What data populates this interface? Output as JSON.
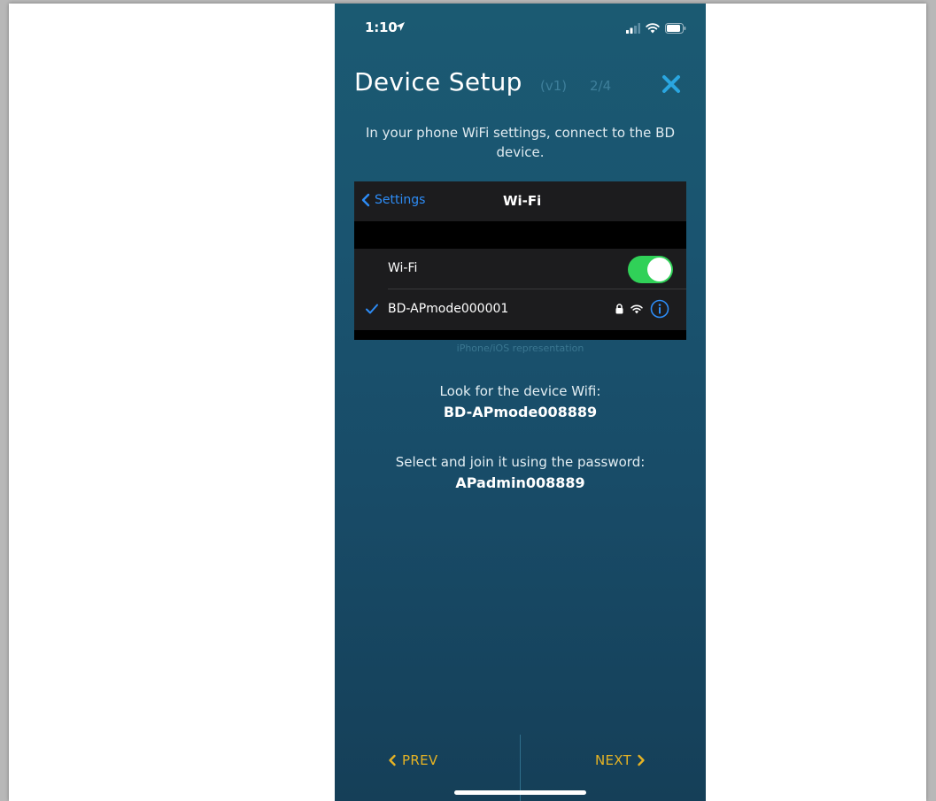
{
  "status_bar": {
    "time": "1:10",
    "icons": [
      "location-arrow-icon",
      "signal-icon",
      "wifi-icon",
      "battery-icon"
    ]
  },
  "header": {
    "title": "Device Setup",
    "version": "(v1)",
    "step": "2/4",
    "close_icon": "close-icon"
  },
  "intro_text": "In your phone WiFi settings, connect to the BD device.",
  "wifi_screenshot": {
    "back_label": "Settings",
    "title": "Wi-Fi",
    "toggle_label": "Wi-Fi",
    "toggle_on": true,
    "network_name": "BD-APmode000001",
    "network_icons": [
      "lock-icon",
      "wifi-icon",
      "info-icon"
    ],
    "caption": "iPhone/iOS representation"
  },
  "device_wifi": {
    "label": "Look for the device Wifi:",
    "value": "BD-APmode008889"
  },
  "password": {
    "label": "Select and join it using the password:",
    "value": "APadmin008889"
  },
  "nav": {
    "prev_label": "PREV",
    "next_label": "NEXT"
  },
  "colors": {
    "background_top": "#1b5a72",
    "background_bottom": "#153f58",
    "accent_close": "#2aa6e0",
    "nav_text": "#e6b324",
    "toggle_on": "#30d158",
    "ios_blue": "#2d8cf6"
  }
}
